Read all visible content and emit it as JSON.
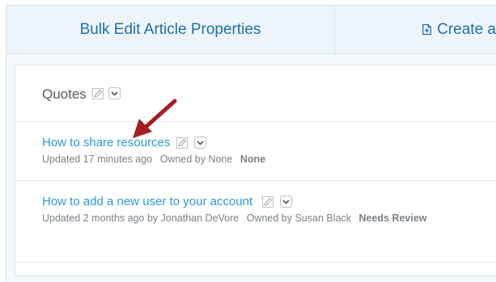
{
  "tabs": {
    "bulk_edit_label": "Bulk Edit Article Properties",
    "create_label": "Create a"
  },
  "section": {
    "title": "Quotes"
  },
  "articles": [
    {
      "title": "How to share resources",
      "updated": "Updated 17 minutes ago",
      "owned": "Owned by None",
      "status": "None"
    },
    {
      "title": "How to add a new user to your account",
      "updated": "Updated 2 months ago by Jonathan DeVore",
      "owned": "Owned by Susan Black",
      "status": "Needs Review"
    }
  ],
  "colors": {
    "link": "#2a9ad8",
    "tab_text": "#1f6fa8",
    "arrow": "#a31f23"
  },
  "icons": [
    "edit-icon",
    "chevron-down-icon",
    "new-document-icon",
    "annotation-arrow"
  ]
}
